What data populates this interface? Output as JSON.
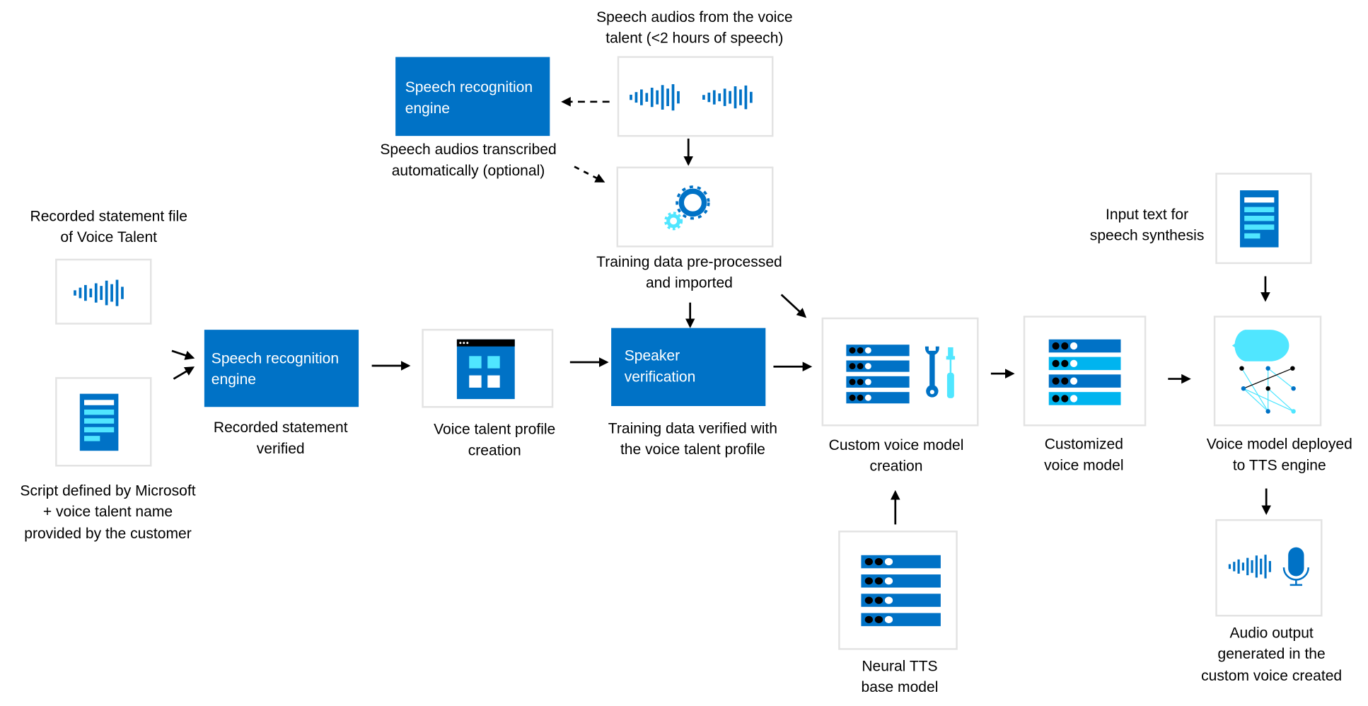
{
  "colors": {
    "primary_blue": "#0072C6",
    "cyan": "#50E6FF",
    "light_blue": "#00B4EF",
    "box_border": "#e3e3e3"
  },
  "top_audio": {
    "label": [
      "Speech audios from the voice",
      "talent (<2 hours of speech)"
    ]
  },
  "sr_engine_top": {
    "label": [
      "Speech recognition",
      "engine"
    ]
  },
  "transcribed": {
    "label": [
      "Speech audios transcribed",
      "automatically (optional)"
    ]
  },
  "preprocessed": {
    "label": [
      "Training data pre-processed",
      "and imported"
    ]
  },
  "recorded_file": {
    "label": [
      "Recorded statement file",
      "of Voice Talent"
    ]
  },
  "script": {
    "label": [
      "Script defined by Microsoft",
      "+ voice talent name",
      "provided by the customer"
    ]
  },
  "sr_engine_main": {
    "label": [
      "Speech recognition",
      "engine"
    ]
  },
  "recorded_verified": {
    "label": [
      "Recorded statement",
      "verified"
    ]
  },
  "profile_creation": {
    "label": [
      "Voice talent profile",
      "creation"
    ]
  },
  "speaker_verification": {
    "label": [
      "Speaker",
      "verification"
    ]
  },
  "training_verified": {
    "label": [
      "Training data verified with",
      "the voice talent profile"
    ]
  },
  "custom_model_creation": {
    "label": [
      "Custom voice model",
      "creation"
    ]
  },
  "neural_tts": {
    "label": [
      "Neural TTS",
      "base model"
    ]
  },
  "customized_model": {
    "label": [
      "Customized",
      "voice model"
    ]
  },
  "deployed": {
    "label": [
      "Voice model deployed",
      "to TTS engine"
    ]
  },
  "input_text": {
    "label": [
      "Input text for",
      "speech synthesis"
    ]
  },
  "audio_output": {
    "label": [
      "Audio output",
      "generated in the",
      "custom voice created"
    ]
  },
  "icons": [
    "waveform-icon",
    "gear-icon",
    "document-icon",
    "window-icon",
    "server-icon",
    "wrench-icon",
    "screwdriver-icon",
    "speech-bubble-icon",
    "network-icon",
    "microphone-icon"
  ]
}
